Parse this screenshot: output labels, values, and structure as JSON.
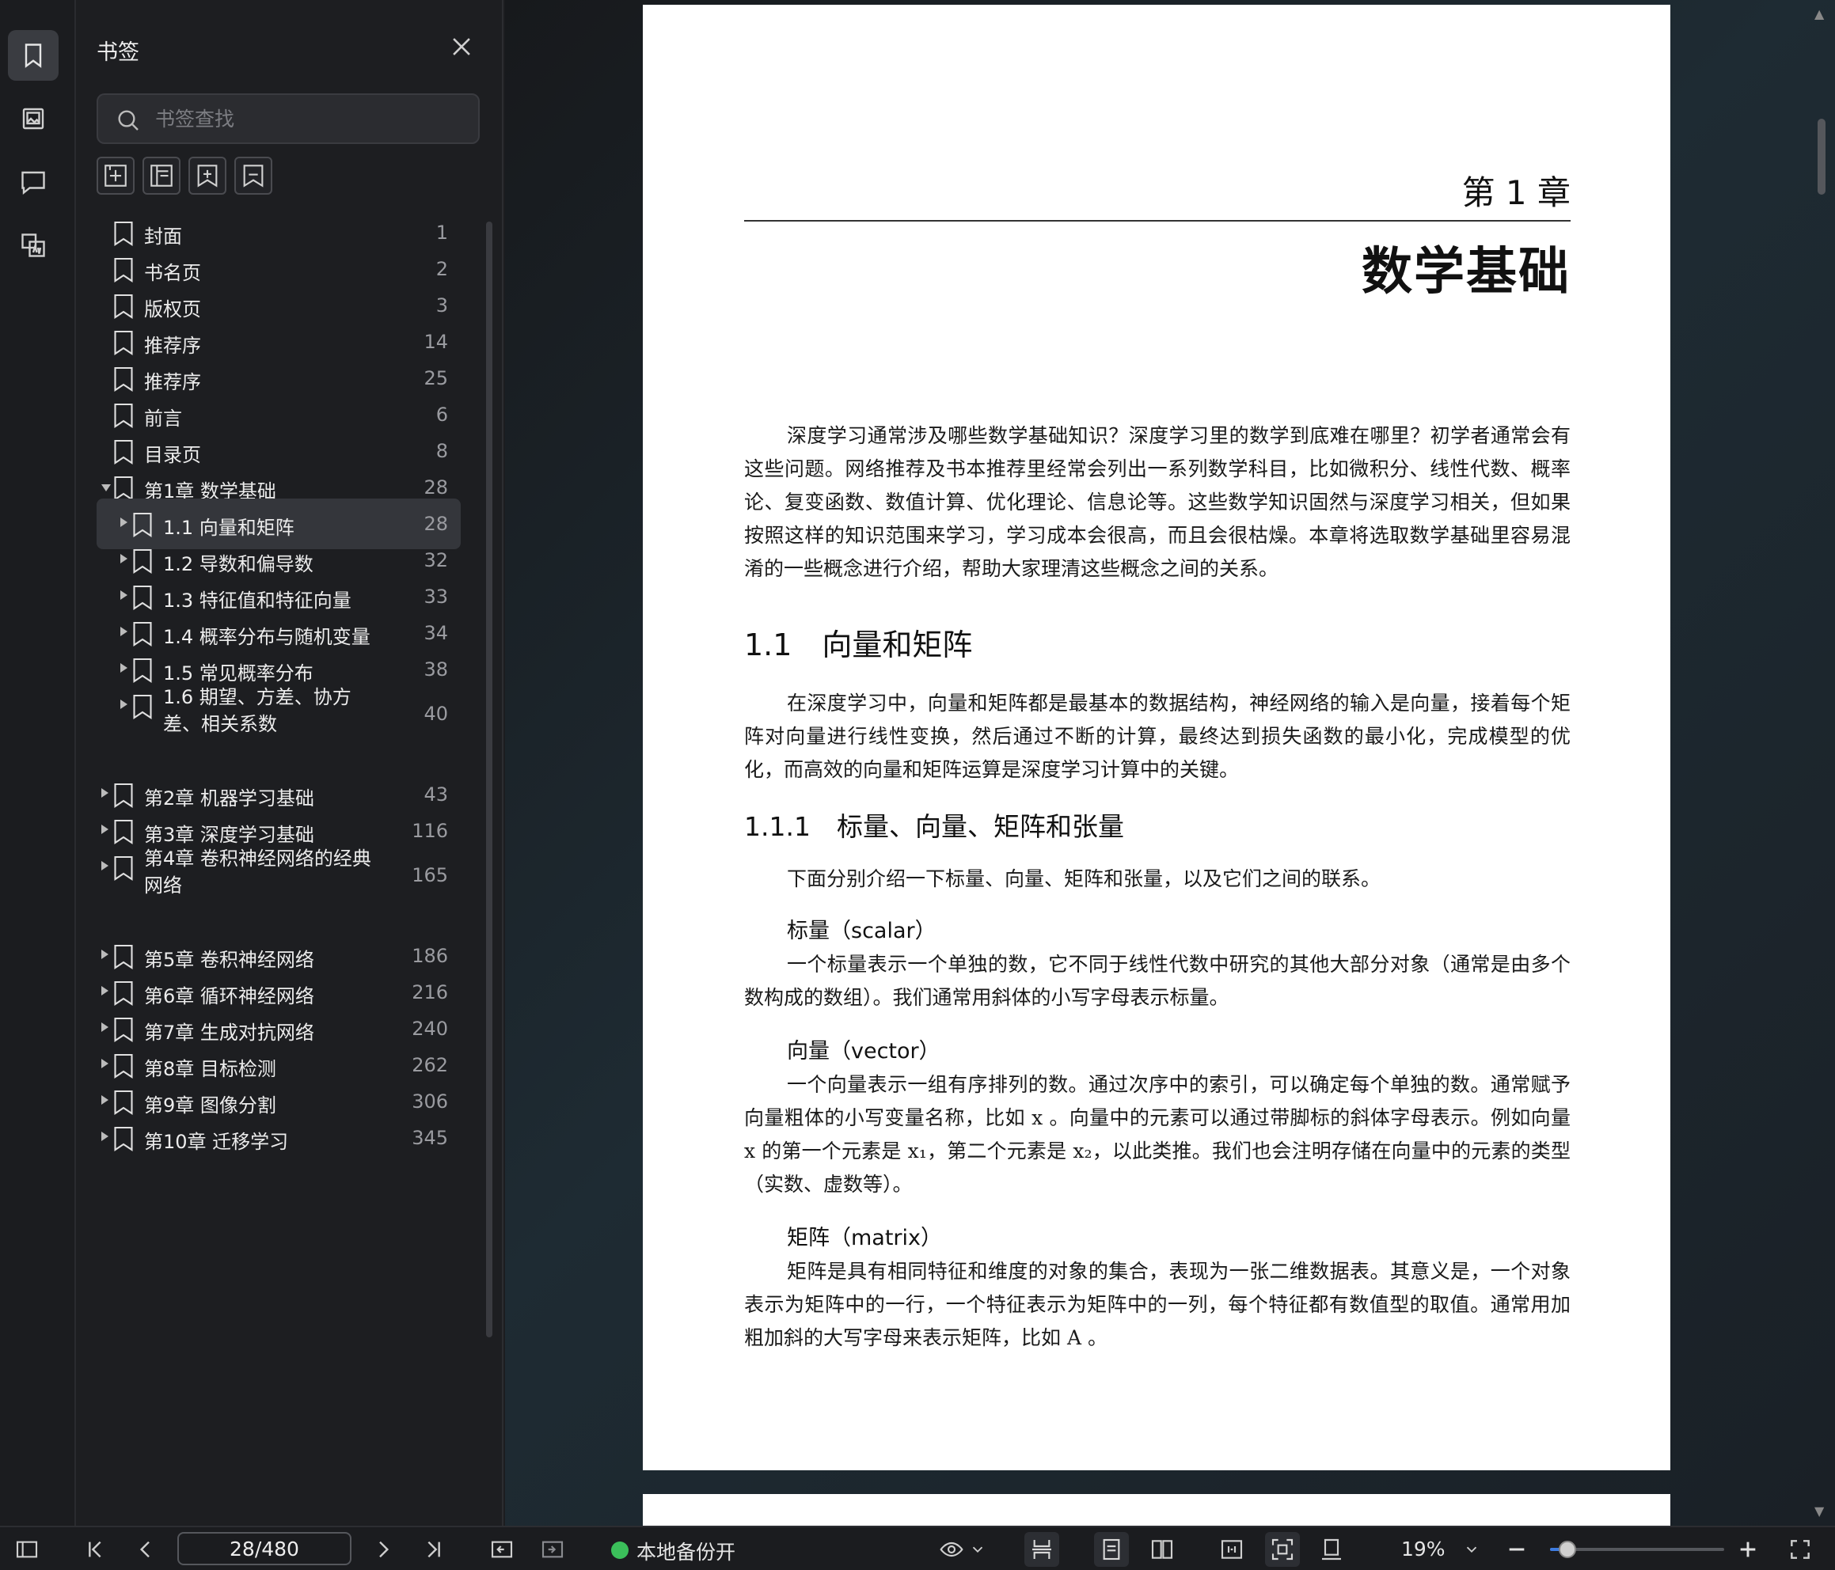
{
  "sidebar_rail": {
    "items": [
      {
        "name": "bookmark-rail-icon",
        "active": true
      },
      {
        "name": "image-rail-icon",
        "active": false
      },
      {
        "name": "comment-rail-icon",
        "active": false
      },
      {
        "name": "translate-rail-icon",
        "active": false
      }
    ]
  },
  "bookmark_panel": {
    "title": "书签",
    "search_placeholder": "书签查找",
    "toolbar_icons": [
      "add-bookmark-icon",
      "add-sub-bookmark-icon",
      "bookmark-import-icon",
      "bookmark-remove-icon"
    ],
    "items": [
      {
        "label": "封面",
        "page": "1",
        "level": 0,
        "expand": "none",
        "selected": false
      },
      {
        "label": "书名页",
        "page": "2",
        "level": 0,
        "expand": "none",
        "selected": false
      },
      {
        "label": "版权页",
        "page": "3",
        "level": 0,
        "expand": "none",
        "selected": false
      },
      {
        "label": "推荐序",
        "page": "14",
        "level": 0,
        "expand": "none",
        "selected": false
      },
      {
        "label": "推荐序",
        "page": "25",
        "level": 0,
        "expand": "none",
        "selected": false
      },
      {
        "label": "前言",
        "page": "6",
        "level": 0,
        "expand": "none",
        "selected": false
      },
      {
        "label": "目录页",
        "page": "8",
        "level": 0,
        "expand": "none",
        "selected": false
      },
      {
        "label": "第1章 数学基础",
        "page": "28",
        "level": 0,
        "expand": "open",
        "selected": false
      },
      {
        "label": "1.1 向量和矩阵",
        "page": "28",
        "level": 1,
        "expand": "closed",
        "selected": true
      },
      {
        "label": "1.2 导数和偏导数",
        "page": "32",
        "level": 1,
        "expand": "closed",
        "selected": false
      },
      {
        "label": "1.3 特征值和特征向量",
        "page": "33",
        "level": 1,
        "expand": "closed",
        "selected": false
      },
      {
        "label": "1.4 概率分布与随机变量",
        "page": "34",
        "level": 1,
        "expand": "closed",
        "selected": false
      },
      {
        "label": "1.5 常见概率分布",
        "page": "38",
        "level": 1,
        "expand": "closed",
        "selected": false
      },
      {
        "label": "1.6 期望、方差、协方差、相关系数",
        "page": "40",
        "level": 1,
        "expand": "closed",
        "selected": false,
        "two_line": true
      },
      {
        "label": "第2章 机器学习基础",
        "page": "43",
        "level": 0,
        "expand": "closed",
        "selected": false
      },
      {
        "label": "第3章 深度学习基础",
        "page": "116",
        "level": 0,
        "expand": "closed",
        "selected": false
      },
      {
        "label": "第4章 卷积神经网络的经典网络",
        "page": "165",
        "level": 0,
        "expand": "closed",
        "selected": false,
        "two_line": true
      },
      {
        "label": "第5章 卷积神经网络",
        "page": "186",
        "level": 0,
        "expand": "closed",
        "selected": false
      },
      {
        "label": "第6章 循环神经网络",
        "page": "216",
        "level": 0,
        "expand": "closed",
        "selected": false
      },
      {
        "label": "第7章 生成对抗网络",
        "page": "240",
        "level": 0,
        "expand": "closed",
        "selected": false
      },
      {
        "label": "第8章 目标检测",
        "page": "262",
        "level": 0,
        "expand": "closed",
        "selected": false
      },
      {
        "label": "第9章 图像分割",
        "page": "306",
        "level": 0,
        "expand": "closed",
        "selected": false
      },
      {
        "label": "第10章 迁移学习",
        "page": "345",
        "level": 0,
        "expand": "closed",
        "selected": false
      }
    ]
  },
  "document": {
    "chapter_number": "第 1 章",
    "chapter_title": "数学基础",
    "intro": "深度学习通常涉及哪些数学基础知识？深度学习里的数学到底难在哪里？初学者通常会有这些问题。网络推荐及书本推荐里经常会列出一系列数学科目，比如微积分、线性代数、概率论、复变函数、数值计算、优化理论、信息论等。这些数学知识固然与深度学习相关，但如果按照这样的知识范围来学习，学习成本会很高，而且会很枯燥。本章将选取数学基础里容易混淆的一些概念进行介绍，帮助大家理清这些概念之间的关系。",
    "section_1_1": "1.1　向量和矩阵",
    "section_1_1_body": "在深度学习中，向量和矩阵都是最基本的数据结构，神经网络的输入是向量，接着每个矩阵对向量进行线性变换，然后通过不断的计算，最终达到损失函数的最小化，完成模型的优化，而高效的向量和矩阵运算是深度学习计算中的关键。",
    "section_1_1_1": "1.1.1　标量、向量、矩阵和张量",
    "section_1_1_1_body": "下面分别介绍一下标量、向量、矩阵和张量，以及它们之间的联系。",
    "scalar_heading": "标量（scalar）",
    "scalar_body": "一个标量表示一个单独的数，它不同于线性代数中研究的其他大部分对象（通常是由多个数构成的数组）。我们通常用斜体的小写字母表示标量。",
    "vector_heading": "向量（vector）",
    "vector_body": "一个向量表示一组有序排列的数。通过次序中的索引，可以确定每个单独的数。通常赋予向量粗体的小写变量名称，比如 x 。向量中的元素可以通过带脚标的斜体字母表示。例如向量 x 的第一个元素是 x₁，第二个元素是 x₂，以此类推。我们也会注明存储在向量中的元素的类型（实数、虚数等）。",
    "matrix_heading": "矩阵（matrix）",
    "matrix_body": "矩阵是具有相同特征和维度的对象的集合，表现为一张二维数据表。其意义是，一个对象表示为矩阵中的一行，一个特征表示为矩阵中的一列，每个特征都有数值型的取值。通常用加粗加斜的大写字母来表示矩阵，比如 A 。"
  },
  "statusbar": {
    "page_indicator": "28/480",
    "backup_label": "本地备份开",
    "zoom_label": "19%",
    "zoom_fraction": 0.1,
    "accent_color": "#3d7be0",
    "backup_status_color": "#3bbf5a"
  }
}
